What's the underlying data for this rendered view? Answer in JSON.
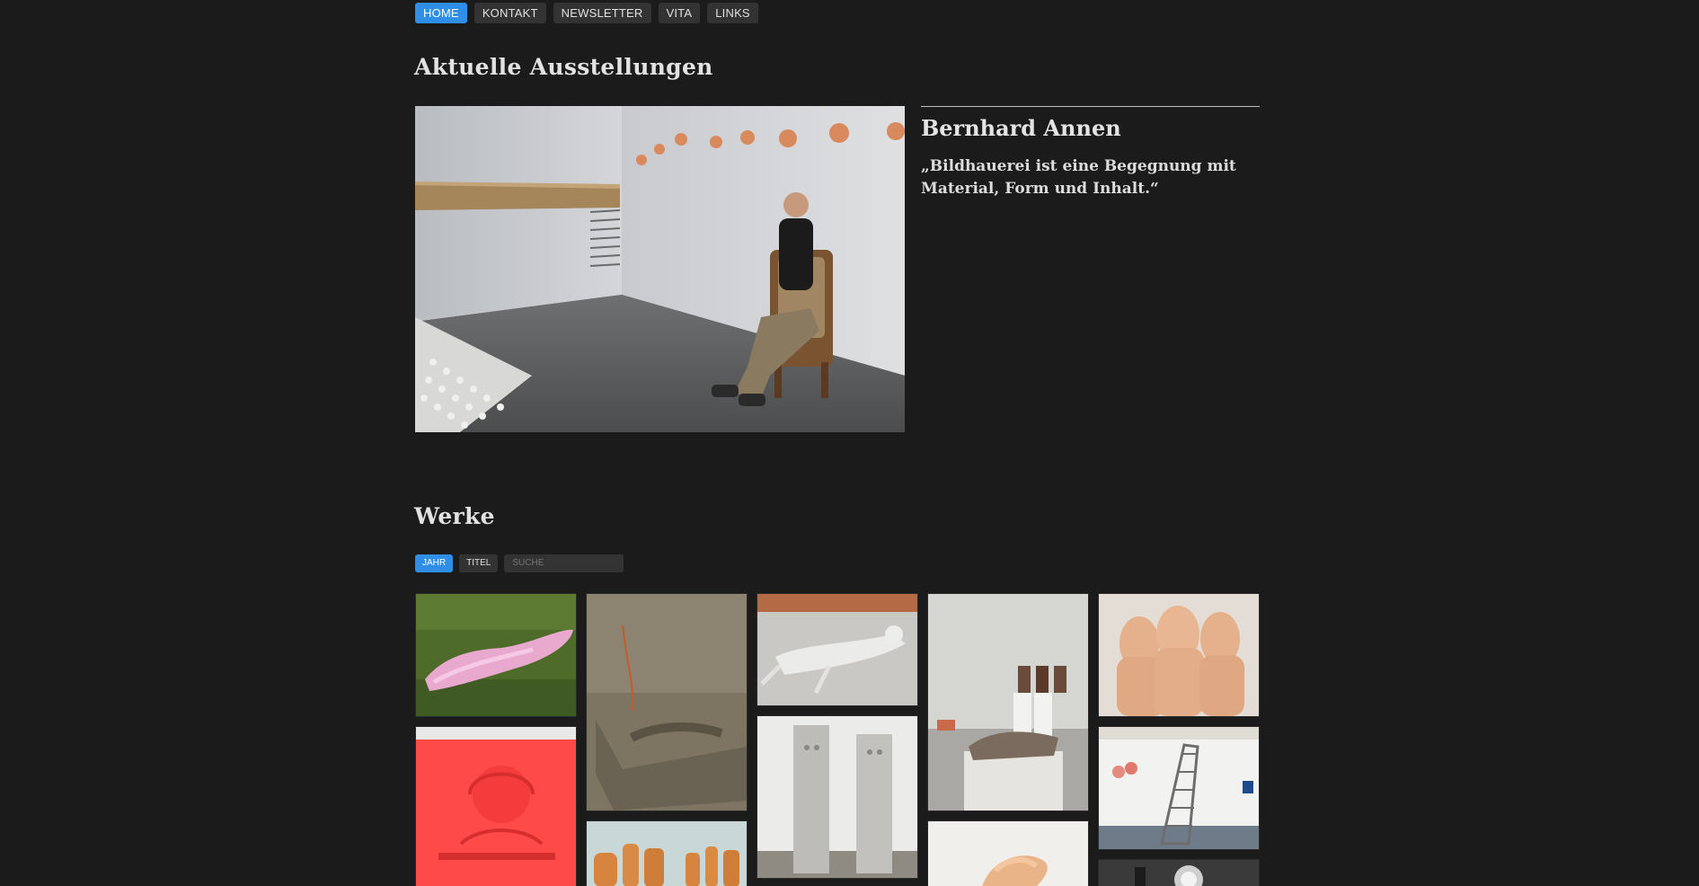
{
  "nav": {
    "items": [
      {
        "label": "HOME",
        "active": true
      },
      {
        "label": "KONTAKT",
        "active": false
      },
      {
        "label": "NEWSLETTER",
        "active": false
      },
      {
        "label": "VITA",
        "active": false
      },
      {
        "label": "LINKS",
        "active": false
      }
    ]
  },
  "exhibitions": {
    "heading": "Aktuelle Ausstellungen",
    "artist": "Bernhard Annen",
    "quote": "„Bildhauerei ist eine Begegnung mit Material, Form und Inhalt.“"
  },
  "works": {
    "heading": "Werke",
    "filters": [
      {
        "label": "JAHR",
        "active": true
      },
      {
        "label": "TITEL",
        "active": false
      }
    ],
    "search_placeholder": "SUCHE"
  },
  "colors": {
    "background": "#1b1b1b",
    "accent": "#2f8fe6",
    "button": "#333333"
  }
}
